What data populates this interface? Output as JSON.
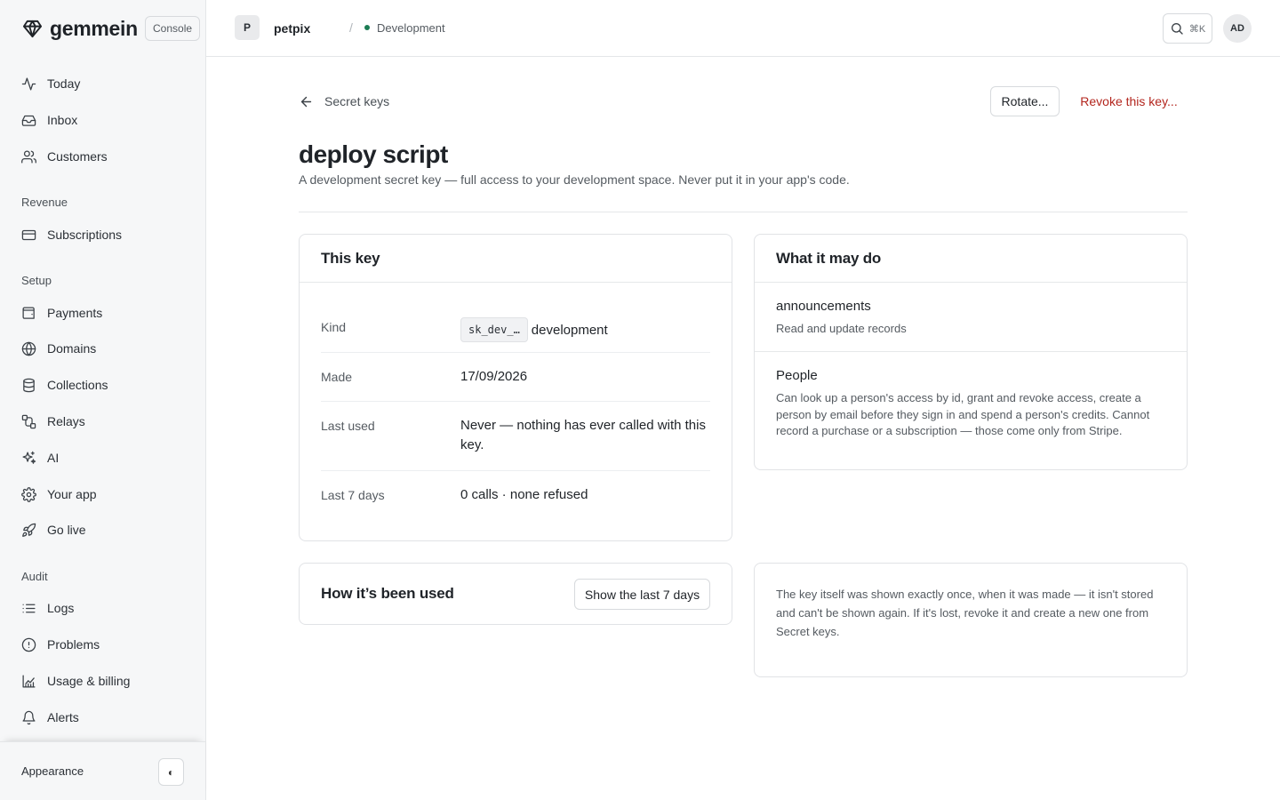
{
  "brand": {
    "name": "gemmein",
    "console_label": "Console"
  },
  "sidebar": {
    "primary": [
      {
        "label": "Today",
        "icon": "activity-icon"
      },
      {
        "label": "Inbox",
        "icon": "inbox-icon"
      },
      {
        "label": "Customers",
        "icon": "users-icon"
      }
    ],
    "sections": [
      {
        "title": "Revenue",
        "items": [
          {
            "label": "Subscriptions",
            "icon": "credit-card-icon"
          }
        ]
      },
      {
        "title": "Setup",
        "items": [
          {
            "label": "Payments",
            "icon": "wallet-icon"
          },
          {
            "label": "Domains",
            "icon": "globe-icon"
          },
          {
            "label": "Collections",
            "icon": "database-icon"
          },
          {
            "label": "Relays",
            "icon": "route-icon"
          },
          {
            "label": "AI",
            "icon": "sparkles-icon"
          },
          {
            "label": "Your app",
            "icon": "gear-icon"
          },
          {
            "label": "Go live",
            "icon": "rocket-icon"
          }
        ]
      },
      {
        "title": "Audit",
        "items": [
          {
            "label": "Logs",
            "icon": "list-icon"
          },
          {
            "label": "Problems",
            "icon": "alert-circle-icon"
          },
          {
            "label": "Usage & billing",
            "icon": "chart-icon"
          },
          {
            "label": "Alerts",
            "icon": "bell-icon"
          }
        ]
      }
    ],
    "appearance_label": "Appearance",
    "appearance_toggle": "◐"
  },
  "topbar": {
    "project_initial": "P",
    "project_name": "petpix",
    "separator": "/",
    "environment": "Development",
    "environment_color": "#1c7c54",
    "search_shortcut": "⌘K",
    "user_initials": "AD"
  },
  "page": {
    "back_label": "Secret keys",
    "rotate_label": "Rotate...",
    "revoke_label": "Revoke this key...",
    "title": "deploy script",
    "subtitle": "A development secret key — full access to your development space. Never put it in your app's code."
  },
  "key_card": {
    "title": "This key",
    "rows": [
      {
        "label": "Kind",
        "prefix": "sk_dev_…",
        "value": "development"
      },
      {
        "label": "Made",
        "value": "17/09/2026"
      },
      {
        "label": "Last used",
        "value": "Never — nothing has ever called with this key."
      },
      {
        "label": "Last 7 days",
        "value": "0 calls · none refused"
      }
    ]
  },
  "perm_card": {
    "title": "What it may do",
    "items": [
      {
        "name": "announcements",
        "desc": "Read and update records"
      },
      {
        "name": "People",
        "desc": "Can look up a person's access by id, grant and revoke access, create a person by email before they sign in and spend a person's credits. Cannot record a purchase or a subscription — those come only from Stripe."
      }
    ]
  },
  "usage_card": {
    "title": "How it’s been used",
    "button_label": "Show the last 7 days"
  },
  "note": "The key itself was shown exactly once, when it was made — it isn't stored and can't be shown again. If it's lost, revoke it and create a new one from Secret keys.",
  "colors": {
    "danger": "#b3261e",
    "sidebar_bg": "#f6f7f8",
    "border": "#e4e6e8"
  }
}
